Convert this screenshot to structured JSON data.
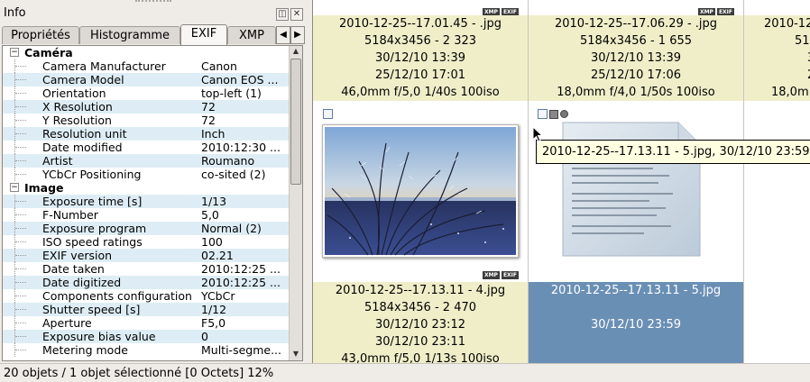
{
  "panel": {
    "title": "Info",
    "tabs": [
      "Propriétés",
      "Histogramme",
      "EXIF",
      "XMP"
    ],
    "active_tab": "EXIF"
  },
  "exif": {
    "sections": [
      {
        "name": "Caméra",
        "rows": [
          {
            "k": "Camera Manufacturer",
            "v": "Canon"
          },
          {
            "k": "Camera Model",
            "v": "Canon EOS ..."
          },
          {
            "k": "Orientation",
            "v": "top-left (1)"
          },
          {
            "k": "X Resolution",
            "v": "72"
          },
          {
            "k": "Y Resolution",
            "v": "72"
          },
          {
            "k": "Resolution unit",
            "v": "Inch"
          },
          {
            "k": "Date modified",
            "v": "2010:12:30 ..."
          },
          {
            "k": "Artist",
            "v": "Roumano"
          },
          {
            "k": "YCbCr Positioning",
            "v": "co-sited (2)"
          }
        ]
      },
      {
        "name": "Image",
        "rows": [
          {
            "k": "Exposure time [s]",
            "v": "1/13"
          },
          {
            "k": "F-Number",
            "v": "5,0"
          },
          {
            "k": "Exposure program",
            "v": "Normal (2)"
          },
          {
            "k": "ISO speed ratings",
            "v": "100"
          },
          {
            "k": "EXIF version",
            "v": "02.21"
          },
          {
            "k": "Date taken",
            "v": "2010:12:25 ..."
          },
          {
            "k": "Date digitized",
            "v": "2010:12:25 ..."
          },
          {
            "k": "Components configuration",
            "v": "YCbCr"
          },
          {
            "k": "Shutter speed [s]",
            "v": "1/12"
          },
          {
            "k": "Aperture",
            "v": "F5,0"
          },
          {
            "k": "Exposure bias value",
            "v": "0"
          },
          {
            "k": "Metering mode",
            "v": "Multi-segme..."
          }
        ]
      }
    ]
  },
  "badges": {
    "xmp": "XMP",
    "exif": "EXIF"
  },
  "thumbs": {
    "top1": [
      "2010-12-25--17.01.45 - .jpg",
      "5184x3456 - 2 323",
      "30/12/10 13:39",
      "25/12/10 17:01",
      "46,0mm f/5,0 1/40s 100iso"
    ],
    "top2": [
      "2010-12-25--17.06.29 - .jpg",
      "5184x3456 - 1 655",
      "30/12/10 13:39",
      "25/12/10 17:06",
      "18,0mm f/4,0 1/50s 100iso"
    ],
    "top3": [
      "2010-12-2",
      "51",
      "3",
      "2",
      "18,0m"
    ],
    "bot1": [
      "2010-12-25--17.13.11 - 4.jpg",
      "5184x3456 - 2 470",
      "30/12/10 23:12",
      "30/12/10 23:11",
      "43,0mm f/5,0 1/13s 100iso"
    ],
    "bot2": [
      "2010-12-25--17.13.11 - 5.jpg",
      "",
      "30/12/10 23:59",
      "",
      ""
    ]
  },
  "tooltip": "2010-12-25--17.13.11 - 5.jpg, 30/12/10 23:59",
  "status": "20 objets / 1 objet sélectionné [0 Octets]  12%"
}
